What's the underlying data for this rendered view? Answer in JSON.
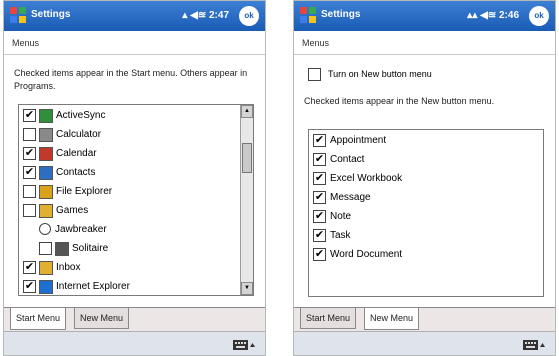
{
  "screens": [
    {
      "title": "Settings",
      "time": "2:47",
      "ok": "ok",
      "header": "Menus",
      "instructions": "Checked items appear in the Start menu. Others appear in Programs.",
      "items": [
        {
          "label": "ActiveSync",
          "checked": true,
          "indent": 0,
          "icon": "activesync-icon"
        },
        {
          "label": "Calculator",
          "checked": false,
          "indent": 0,
          "icon": "calculator-icon"
        },
        {
          "label": "Calendar",
          "checked": true,
          "indent": 0,
          "icon": "calendar-icon"
        },
        {
          "label": "Contacts",
          "checked": true,
          "indent": 0,
          "icon": "contacts-icon"
        },
        {
          "label": "File Explorer",
          "checked": false,
          "indent": 0,
          "icon": "file-explorer-icon"
        },
        {
          "label": "Games",
          "checked": false,
          "indent": 0,
          "icon": "folder-icon"
        },
        {
          "label": "Jawbreaker",
          "checked": false,
          "indent": 1,
          "radio": true,
          "icon": ""
        },
        {
          "label": "Solitaire",
          "checked": false,
          "indent": 1,
          "icon": "solitaire-icon"
        },
        {
          "label": "Inbox",
          "checked": true,
          "indent": 0,
          "icon": "inbox-icon"
        },
        {
          "label": "Internet Explorer",
          "checked": true,
          "indent": 0,
          "icon": "internet-explorer-icon"
        }
      ],
      "tabs": [
        "Start Menu",
        "New Menu"
      ],
      "active_tab": 0
    },
    {
      "title": "Settings",
      "time": "2:46",
      "ok": "ok",
      "header": "Menus",
      "toggle_label": "Turn on New button menu",
      "toggle_checked": false,
      "instructions": "Checked items appear in the New button menu.",
      "items": [
        {
          "label": "Appointment",
          "checked": true
        },
        {
          "label": "Contact",
          "checked": true
        },
        {
          "label": "Excel Workbook",
          "checked": true
        },
        {
          "label": "Message",
          "checked": true
        },
        {
          "label": "Note",
          "checked": true
        },
        {
          "label": "Task",
          "checked": true
        },
        {
          "label": "Word Document",
          "checked": true
        }
      ],
      "tabs": [
        "Start Menu",
        "New Menu"
      ],
      "active_tab": 1
    }
  ],
  "colors": {
    "titlebar": "#1a5cb5",
    "tabbar": "#ece6e6",
    "menubar": "#dfe4ec"
  }
}
